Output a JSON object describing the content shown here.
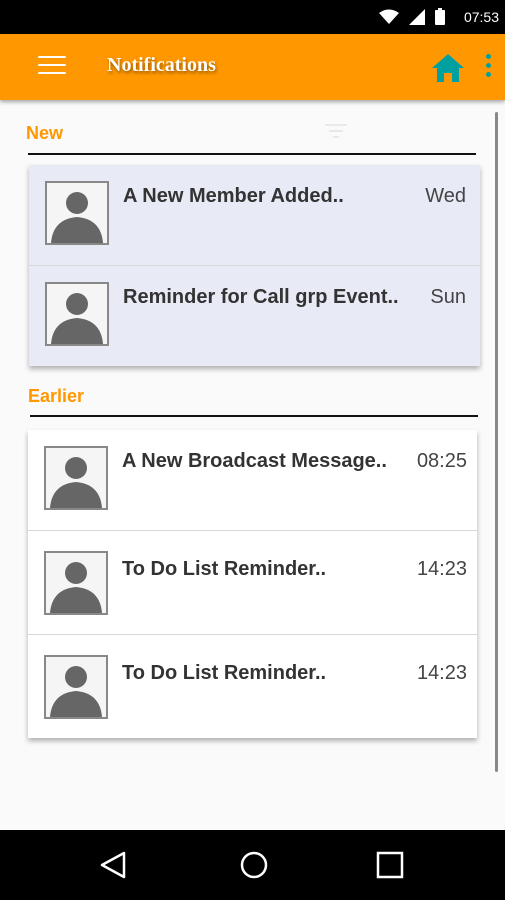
{
  "status_bar": {
    "time": "07:53"
  },
  "app_bar": {
    "title": "Notifications"
  },
  "sections": {
    "new": {
      "label": "New",
      "items": [
        {
          "title": "A New Member Added..",
          "time": "Wed"
        },
        {
          "title": "Reminder for Call grp Event..",
          "time": "Sun"
        }
      ]
    },
    "earlier": {
      "label": "Earlier",
      "items": [
        {
          "title": "A New Broadcast Message..",
          "time": "08:25"
        },
        {
          "title": "To Do List Reminder..",
          "time": "14:23"
        },
        {
          "title": "To Do List Reminder..",
          "time": "14:23"
        }
      ]
    }
  },
  "colors": {
    "accent": "#ff9800",
    "home_icon": "#00a0a0",
    "new_card_bg": "#e8eaf6"
  },
  "icons": [
    "wifi-icon",
    "signal-icon",
    "battery-icon",
    "menu-icon",
    "home-icon",
    "more-vert-icon",
    "avatar-placeholder-icon",
    "back-icon",
    "home-circle-icon",
    "recents-icon"
  ]
}
